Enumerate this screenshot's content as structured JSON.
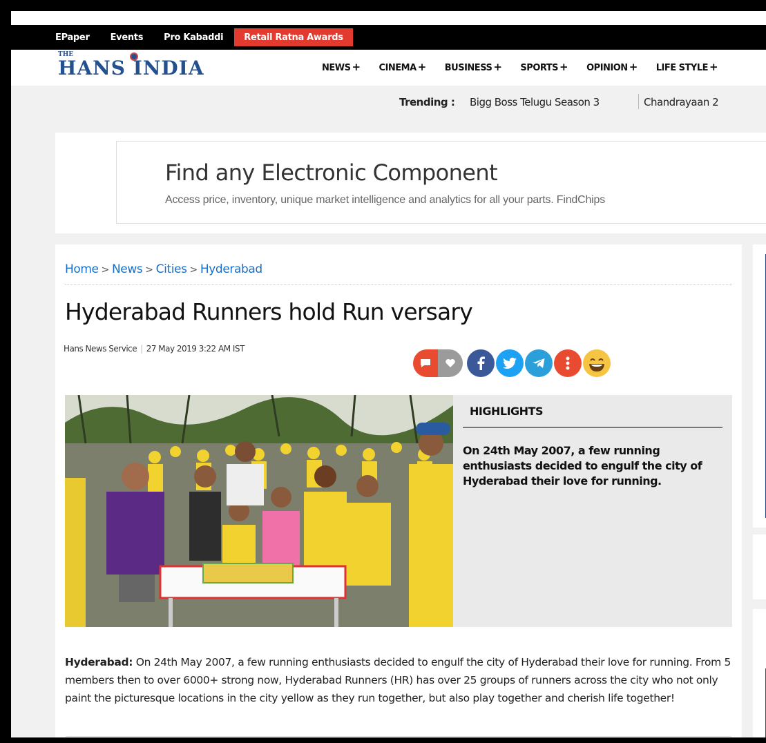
{
  "topbar": {
    "links": [
      "EPaper",
      "Events",
      "Pro Kabaddi"
    ],
    "promo": "Retail Ratna Awards"
  },
  "logo": {
    "small": "THE",
    "name": "HANS INDIA"
  },
  "nav": {
    "items": [
      {
        "label": "NEWS",
        "plus": "+"
      },
      {
        "label": "CINEMA",
        "plus": "+"
      },
      {
        "label": "BUSINESS",
        "plus": "+"
      },
      {
        "label": "SPORTS",
        "plus": "+"
      },
      {
        "label": "OPINION",
        "plus": "+"
      },
      {
        "label": "LIFE STYLE",
        "plus": "+"
      }
    ]
  },
  "trending": {
    "label": "Trending :",
    "items": [
      "Bigg Boss Telugu Season 3",
      "Chandrayaan 2"
    ]
  },
  "ad": {
    "heading": "Find any Electronic Component",
    "subtext": "Access price, inventory, unique market intelligence and analytics for all your parts. FindChips"
  },
  "article": {
    "breadcrumb": [
      "Home",
      "News",
      "Cities",
      "Hyderabad"
    ],
    "title": "Hyderabad Runners hold Run versary",
    "author": "Hans News Service",
    "date": "27 May 2019 3:22 AM IST",
    "highlights_label": "HIGHLIGHTS",
    "highlights_text": "On 24th May 2007, a few running enthusiasts decided to engulf the city of Hyderabad their love for running.",
    "body_lead": "Hyderabad:",
    "body_text": " On 24th May 2007, a few running enthusiasts decided to engulf the city of Hyderabad their love for running. From 5 members then to over 6000+ strong now, Hyderabad Runners (HR) has over 25 groups of runners across the city who not only paint the picturesque locations in the city yellow as they run together, but also play together and cherish life together!"
  },
  "share_icons": [
    "comment-icon",
    "heart-icon",
    "facebook-icon",
    "twitter-icon",
    "telegram-icon",
    "more-icon",
    "emoji-icon"
  ],
  "colors": {
    "promo": "#e23a2f",
    "brand": "#23508f",
    "link": "#1a6ec6",
    "runners_yellow": "#f2d22e"
  }
}
